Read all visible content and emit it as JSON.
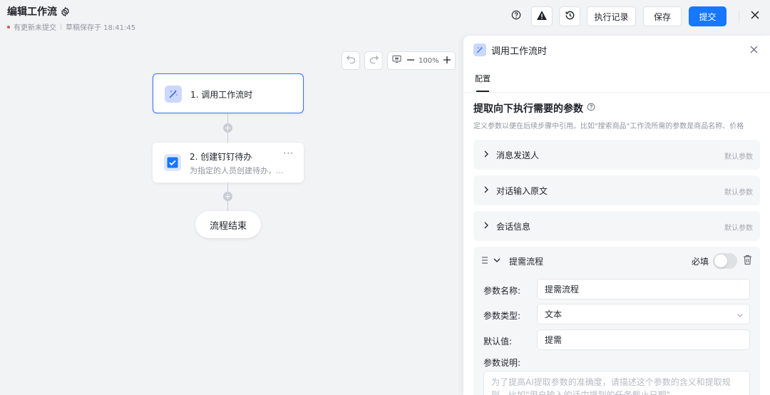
{
  "header": {
    "title": "编辑工作流",
    "unsaved_status": "有更新未提交",
    "draft_status": "草稿保存于 18:41:45",
    "exec_log_label": "执行记录",
    "save_label": "保存",
    "submit_label": "提交"
  },
  "canvas": {
    "zoom_level": "100%"
  },
  "flow": {
    "nodes": [
      {
        "title": "1. 调用工作流时",
        "desc": ""
      },
      {
        "title": "2. 创建钉钉待办",
        "desc": "为指定的人员创建待办，..."
      }
    ],
    "end_label": "流程结束",
    "more_glyph": "···",
    "plus_glyph": "+"
  },
  "panel": {
    "title": "调用工作流时",
    "tab": "配置",
    "section_title": "提取向下执行需要的参数",
    "section_desc": "定义参数以便在后续步骤中引用。比如\"搜索商品\"工作流所需的参数是商品名称、价格",
    "default_params": [
      {
        "name": "消息发送人",
        "tag": "默认参数"
      },
      {
        "name": "对话输入原文",
        "tag": "默认参数"
      },
      {
        "name": "会话信息",
        "tag": "默认参数"
      }
    ],
    "custom_param": {
      "name": "提需流程",
      "required_label": "必填",
      "required": false,
      "fields": {
        "name_label": "参数名称:",
        "name_value": "提需流程",
        "type_label": "参数类型:",
        "type_value": "文本",
        "default_label": "默认值:",
        "default_value": "提需",
        "desc_label": "参数说明:",
        "desc_placeholder": "为了提高AI提取参数的准确度，请描述这个参数的含义和提取规则，比如\"用户输入的话中提到的任务截止日期\""
      }
    }
  },
  "colors": {
    "accent": "#1677ff",
    "selected_border": "#3370ff",
    "unsaved_dot": "#f54a45"
  }
}
